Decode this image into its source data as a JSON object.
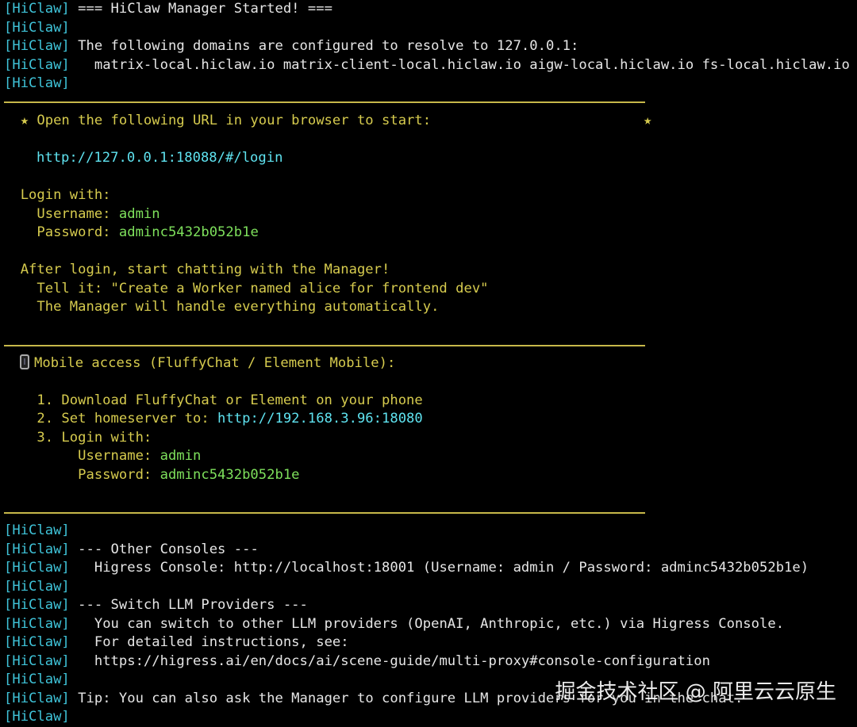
{
  "prefix": "[HiClaw]",
  "header": {
    "started": " === HiClaw Manager Started! ===",
    "domains_intro": " The following domains are configured to resolve to 127.0.0.1:",
    "domains_list": "   matrix-local.hiclaw.io matrix-client-local.hiclaw.io aigw-local.hiclaw.io fs-local.hiclaw.io"
  },
  "box": {
    "open_url_line": "  ★ Open the following URL in your browser to start:",
    "star_right": "★",
    "login_url": "http://127.0.0.1:18088/#/login",
    "login_with": "  Login with:",
    "username_label": "    Username: ",
    "username_value": "admin",
    "password_label": "    Password: ",
    "password_value": "adminc5432b052b1e",
    "after_login": "  After login, start chatting with the Manager!",
    "tell_it": "    Tell it: \"Create a Worker named alice for frontend dev\"",
    "handle": "    The Manager will handle everything automatically."
  },
  "mobile": {
    "title": "Mobile access (FluffyChat / Element Mobile):",
    "step1": "    1. Download FluffyChat or Element on your phone",
    "step2_label": "    2. Set homeserver to: ",
    "step2_url": "http://192.168.3.96:18080",
    "step3": "    3. Login with:",
    "username_label": "         Username: ",
    "username_value": "admin",
    "password_label": "         Password: ",
    "password_value": "adminc5432b052b1e"
  },
  "footer": {
    "other_consoles": " --- Other Consoles ---",
    "higress_console": "   Higress Console: http://localhost:18001 (Username: admin / Password: adminc5432b052b1e)",
    "switch_llm": " --- Switch LLM Providers ---",
    "switch_desc": "   You can switch to other LLM providers (OpenAI, Anthropic, etc.) via Higress Console.",
    "detailed": "   For detailed instructions, see:",
    "docs_url": "   https://higress.ai/en/docs/ai/scene-guide/multi-proxy#console-configuration",
    "tip": " Tip: You can also ask the Manager to configure LLM providers for you in the chat."
  },
  "watermark": "掘金技术社区 @ 阿里云云原生"
}
